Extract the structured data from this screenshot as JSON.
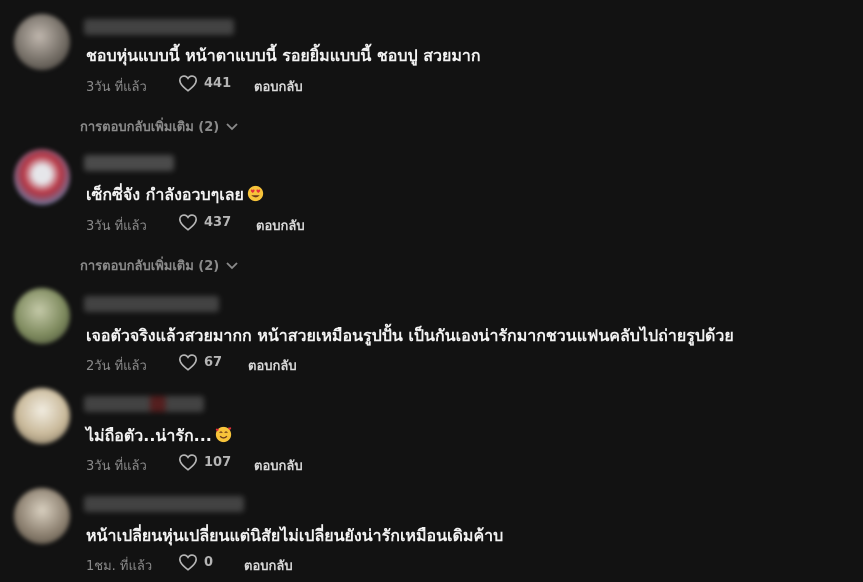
{
  "comments": [
    {
      "text": "ชอบหุ่นแบบนี้ หน้าตาแบบนี้ รอยยิ้มแบบนี้ ชอบปู สวยมาก",
      "time": "3วัน ที่แล้ว",
      "likes": "441",
      "reply_label": "ตอบกลับ",
      "more_replies": "การตอบกลับเพิ่มเติม (2)",
      "emoji": ""
    },
    {
      "text": "เซ็กซี่จัง กำลังอวบๆเลย",
      "time": "3วัน ที่แล้ว",
      "likes": "437",
      "reply_label": "ตอบกลับ",
      "more_replies": "การตอบกลับเพิ่มเติม (2)",
      "emoji": "smiling-face-with-heart-eyes"
    },
    {
      "text": "เจอตัวจริงแล้วสวยมากก หน้าสวยเหมือนรูปปั้น เป็นกันเองน่ารักมากชวนแฟนคลับไปถ่ายรูปด้วย",
      "time": "2วัน ที่แล้ว",
      "likes": "67",
      "reply_label": "ตอบกลับ",
      "more_replies": "",
      "emoji": ""
    },
    {
      "text": "ไม่ถือตัว..น่ารัก...",
      "time": "3วัน ที่แล้ว",
      "likes": "107",
      "reply_label": "ตอบกลับ",
      "more_replies": "",
      "emoji": "smiling-face-with-hearts"
    },
    {
      "text": "หน้าเปลี่ยนหุ่นเปลี่ยนแต่นิสัยไม่เปลี่ยนยังน่ารักเหมือนเดิมค้าบ",
      "time": "1ชม. ที่แล้ว",
      "likes": "0",
      "reply_label": "ตอบกลับ",
      "more_replies": "",
      "emoji": ""
    }
  ],
  "colors": {
    "background": "#121212",
    "text": "#f2f2f2",
    "muted": "#8b8b8b"
  }
}
